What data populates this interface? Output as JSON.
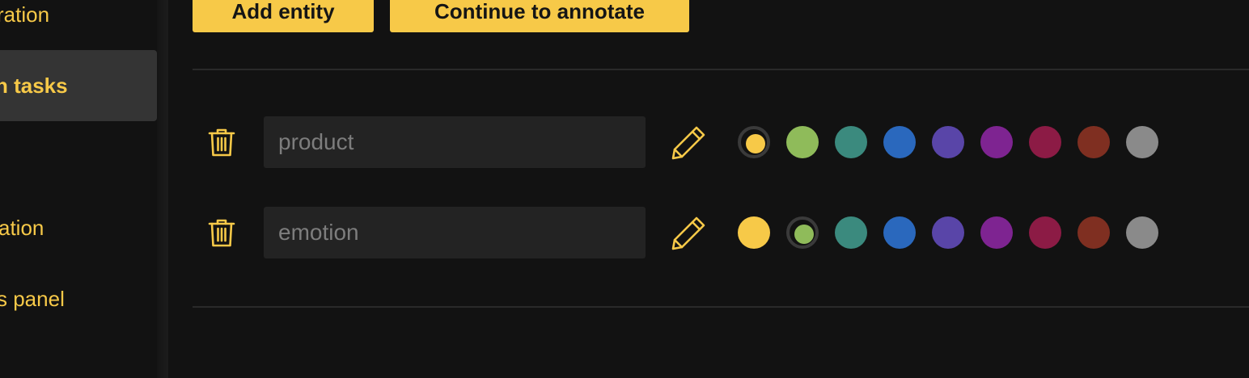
{
  "sidebar": {
    "items": [
      {
        "label": "ration",
        "active": false
      },
      {
        "label": "n tasks",
        "active": true
      },
      {
        "label": "ation",
        "active": false
      },
      {
        "label": "s panel",
        "active": false
      }
    ]
  },
  "toolbar": {
    "add_entity_label": "Add entity",
    "continue_label": "Continue to annotate"
  },
  "entities": [
    {
      "placeholder": "product",
      "value": "",
      "selected_color_index": 0
    },
    {
      "placeholder": "emotion",
      "value": "",
      "selected_color_index": 1
    }
  ],
  "palette": [
    "#f7c948",
    "#8fbb5a",
    "#3b8a7e",
    "#2a68bd",
    "#5945a8",
    "#7e2491",
    "#8c1b45",
    "#7f2f21",
    "#8a8a8a"
  ],
  "colors": {
    "accent": "#f7c948",
    "background": "#121212",
    "input_bg": "#232323"
  }
}
